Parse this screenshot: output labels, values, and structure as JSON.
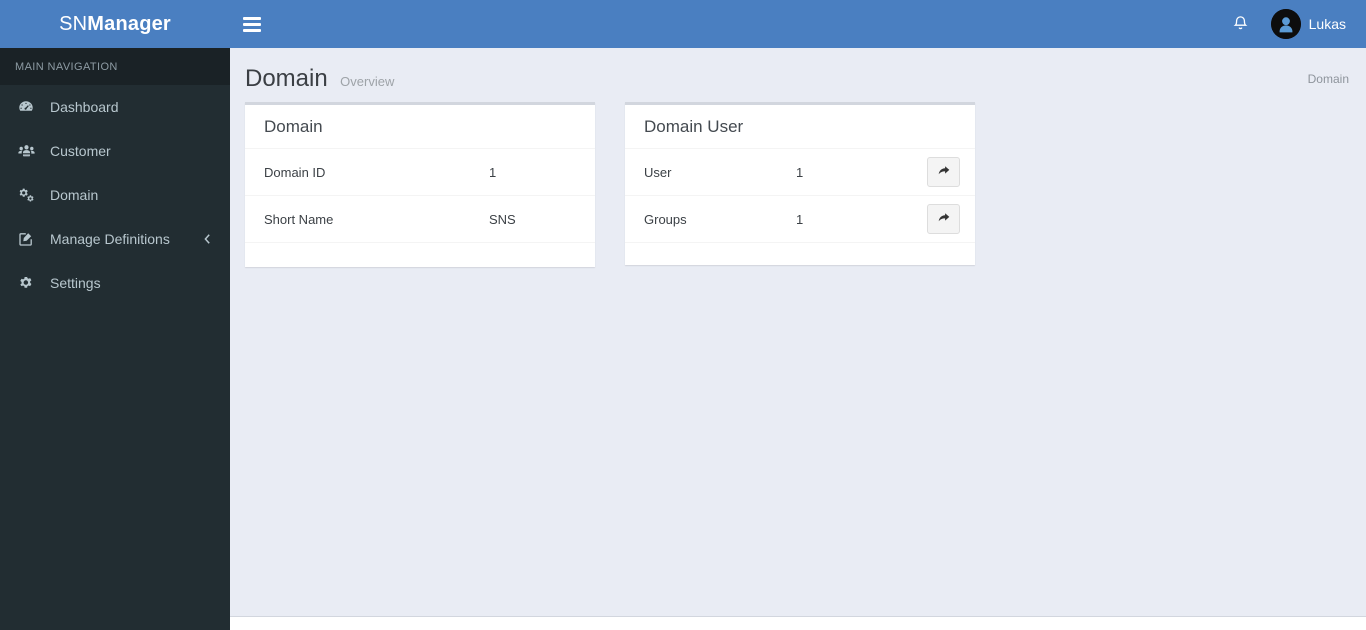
{
  "brand": {
    "logo_light": "SN",
    "logo_bold": "Manager"
  },
  "sidebar": {
    "section_label": "MAIN NAVIGATION",
    "items": [
      {
        "label": "Dashboard",
        "icon": "dashboard-icon"
      },
      {
        "label": "Customer",
        "icon": "users-icon"
      },
      {
        "label": "Domain",
        "icon": "cogs-icon"
      },
      {
        "label": "Manage Definitions",
        "icon": "edit-icon",
        "arrow": "chevron-left-icon"
      },
      {
        "label": "Settings",
        "icon": "gear-icon"
      }
    ]
  },
  "header": {
    "menu_toggle": "hamburger-icon",
    "notifications_icon": "bell-icon",
    "user_name": "Lukas",
    "avatar_icon": "user-avatar"
  },
  "page": {
    "title": "Domain",
    "subtitle": "Overview",
    "breadcrumb": "Domain"
  },
  "cards": {
    "domain": {
      "title": "Domain",
      "rows": [
        {
          "label": "Domain ID",
          "value": "1"
        },
        {
          "label": "Short Name",
          "value": "SNS"
        }
      ]
    },
    "domain_user": {
      "title": "Domain User",
      "rows": [
        {
          "label": "User",
          "value": "1",
          "action_icon": "share-arrow-icon"
        },
        {
          "label": "Groups",
          "value": "1",
          "action_icon": "share-arrow-icon"
        }
      ]
    }
  },
  "colors": {
    "header_blue": "#4a7fc1",
    "sidebar_dark": "#222d32",
    "sidebar_header_dark": "#1a2226",
    "content_bg": "#e9ecf4",
    "card_top_border": "#d2d6de"
  }
}
